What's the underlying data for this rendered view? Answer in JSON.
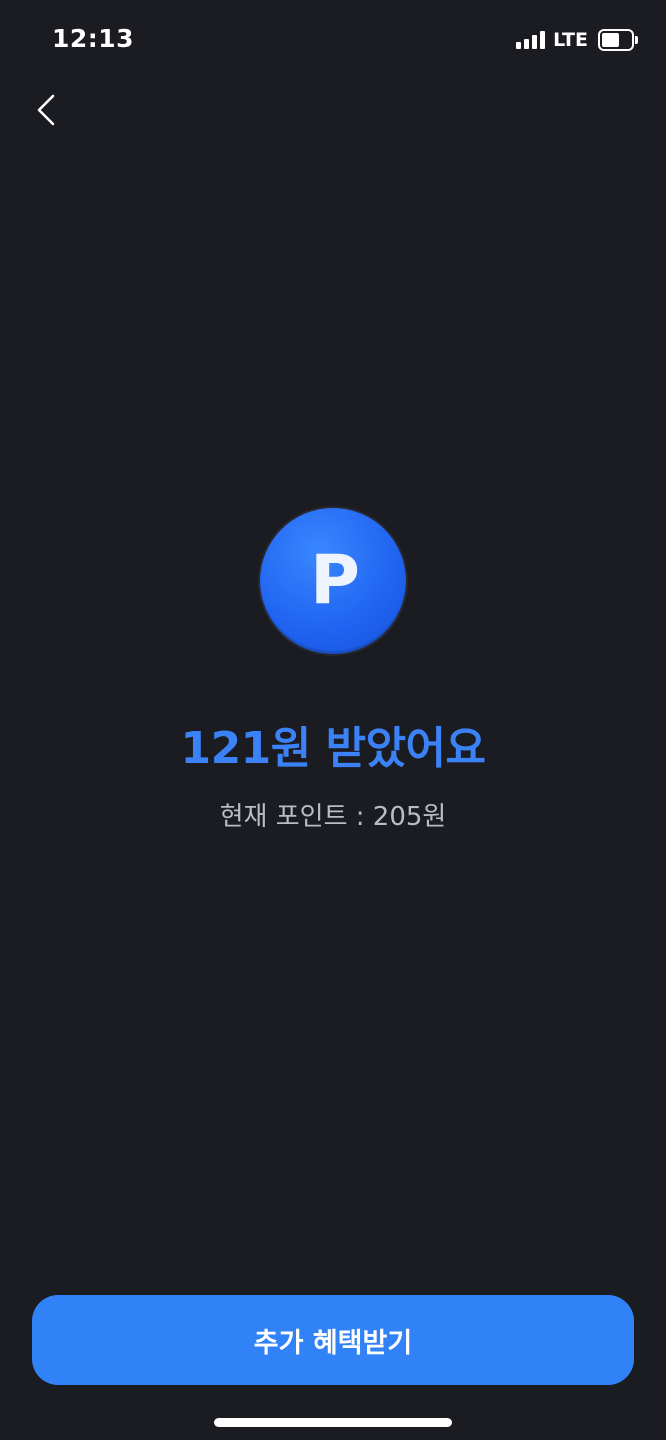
{
  "status_bar": {
    "time": "12:13",
    "network": "LTE",
    "battery_level": 0.6,
    "signal_bars": 4
  },
  "nav": {
    "back_icon": "chevron-left-icon"
  },
  "reward": {
    "coin_letter": "P",
    "title": "121원 받았어요",
    "current_points": "현재 포인트 : 205원"
  },
  "actions": {
    "primary_label": "추가 혜택받기"
  },
  "colors": {
    "background": "#1b1b22",
    "accent": "#3182f6",
    "title": "#3b82f6",
    "subtext": "#b9bcc6"
  }
}
